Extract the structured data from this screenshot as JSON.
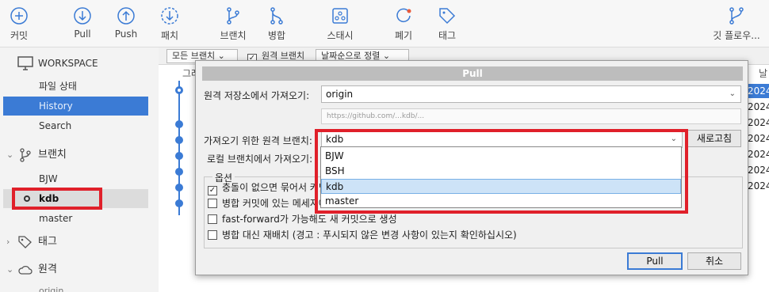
{
  "toolbar": {
    "buttons": [
      {
        "label": "커밋",
        "icon": "plus-circle-icon"
      },
      {
        "label": "Pull",
        "icon": "arrow-down-circle-icon"
      },
      {
        "label": "Push",
        "icon": "arrow-up-circle-icon"
      },
      {
        "label": "패치",
        "icon": "arrow-down-dashed-circle-icon"
      },
      {
        "label": "브랜치",
        "icon": "branch-icon"
      },
      {
        "label": "병합",
        "icon": "merge-icon"
      },
      {
        "label": "스태시",
        "icon": "stash-icon"
      },
      {
        "label": "폐기",
        "icon": "discard-icon"
      },
      {
        "label": "태그",
        "icon": "tag-icon"
      },
      {
        "label": "깃 플로우...",
        "icon": "git-flow-icon"
      }
    ]
  },
  "sidebar": {
    "workspace_label": "WORKSPACE",
    "workspace_items": [
      "파일 상태",
      "History",
      "Search"
    ],
    "branches_label": "브랜치",
    "branches": [
      "BJW",
      "kdb",
      "master"
    ],
    "current_branch": "kdb",
    "tags_label": "태그",
    "remotes_label": "원격",
    "remote_item": "origin"
  },
  "content": {
    "filter_all_branches": "모든 브랜치",
    "filter_remote_branch": "원격 브랜치",
    "sort_label": "날짜순으로 정렬",
    "col_graph": "그래",
    "col_date": "날",
    "date_prefix": "2024"
  },
  "dialog": {
    "title": "Pull",
    "remote_repo_label": "원격 저장소에서 가져오기:",
    "remote_repo_value": "origin",
    "remote_url": "https://github.com/...kdb/...",
    "remote_branch_label": "가져오기 위한 원격 브랜치:",
    "remote_branch_value": "kdb",
    "refresh_button": "새로고침",
    "local_branch_label": "로컬 브랜치에서 가져오기:",
    "options_title": "옵션",
    "options": [
      {
        "label": "충돌이 없으면 묶어서 커밋",
        "checked": true
      },
      {
        "label": "병합 커밋에 있는 메세지에 포함",
        "checked": false
      },
      {
        "label": "fast-forward가 가능해도 새 커밋으로 생성",
        "checked": false
      },
      {
        "label": "병합 대신 재배치 (경고 : 푸시되지 않은 변경 사항이 있는지 확인하십시오)",
        "checked": false
      }
    ],
    "ok_button": "Pull",
    "cancel_button": "취소",
    "dropdown_options": [
      "BJW",
      "BSH",
      "kdb",
      "master"
    ],
    "dropdown_highlighted": "kdb"
  },
  "colors": {
    "accent": "#3b7bd5",
    "highlight_box": "#e0202a"
  }
}
